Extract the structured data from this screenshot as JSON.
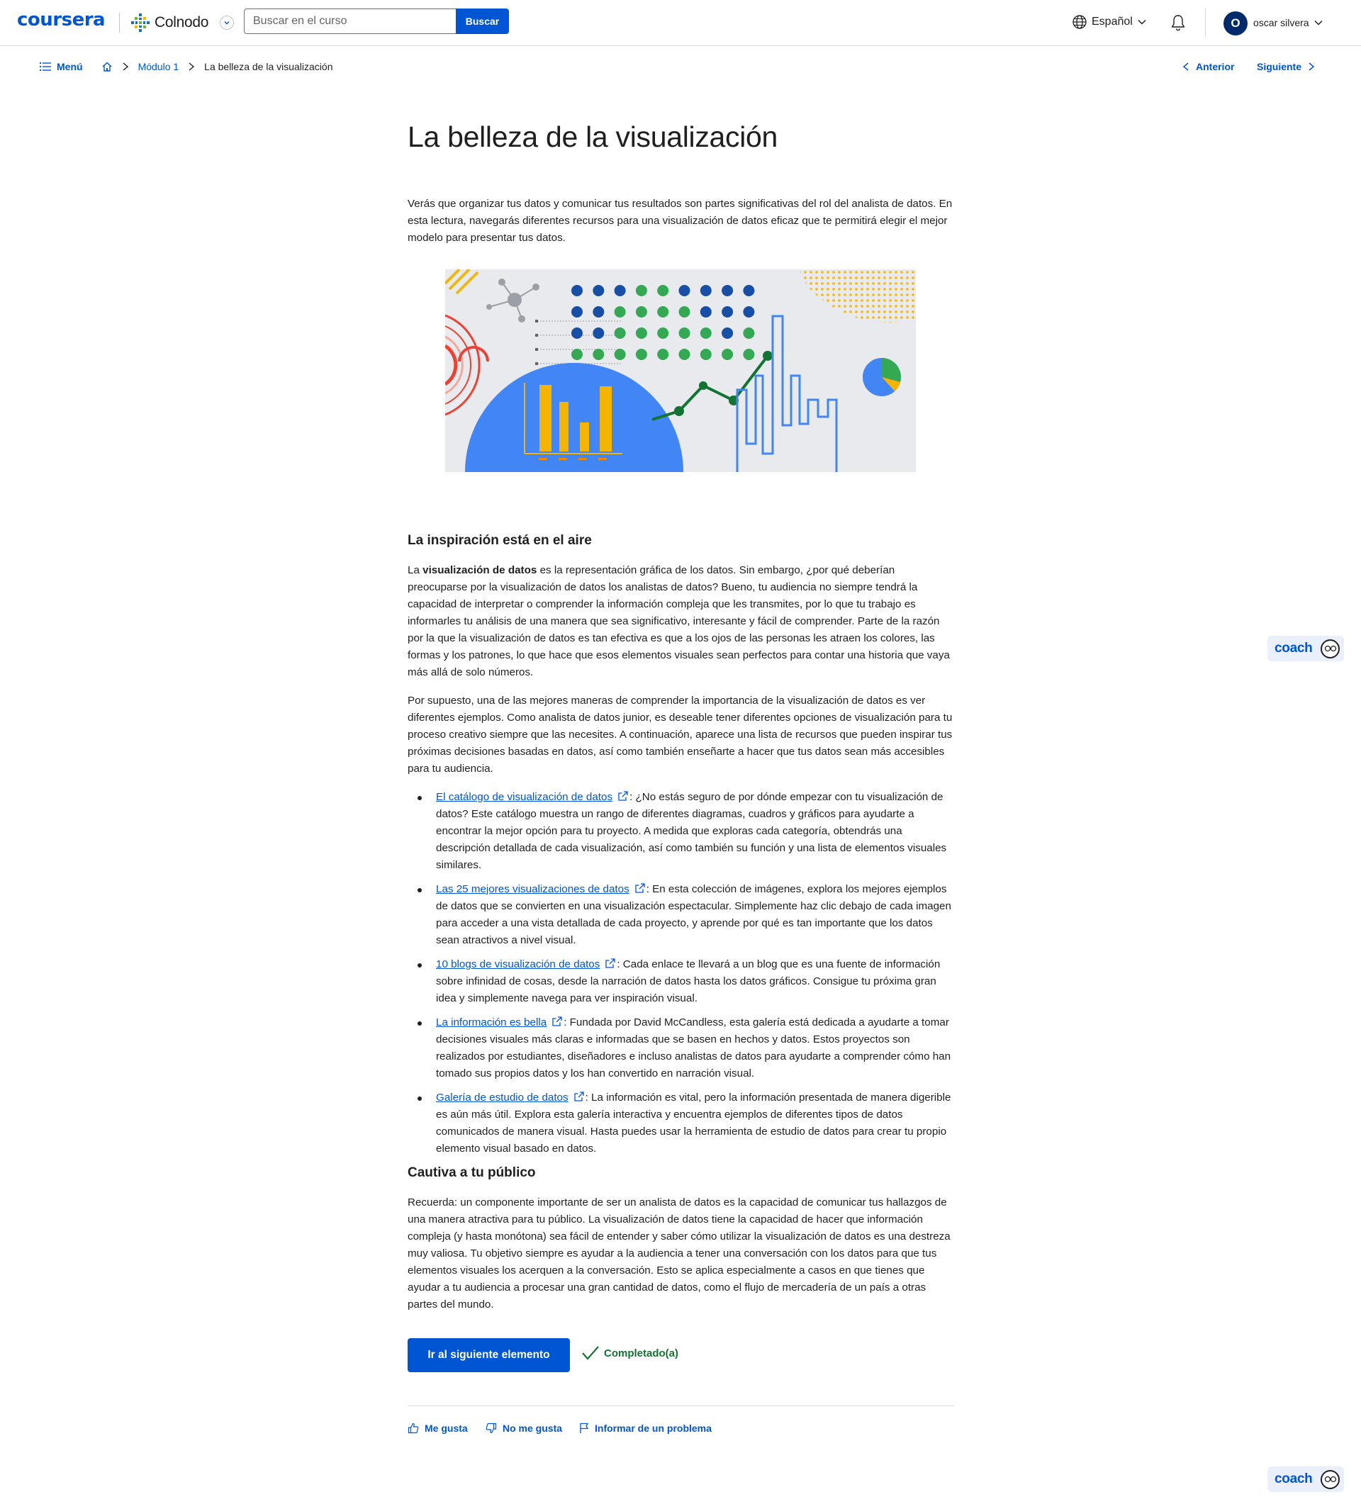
{
  "header": {
    "logo": "coursera",
    "partner": "Colnodo",
    "search_placeholder": "Buscar en el curso",
    "search_button": "Buscar",
    "language": "Español",
    "avatar_initial": "O",
    "user_name": "oscar silvera"
  },
  "breadcrumb": {
    "menu": "Menú",
    "module": "Módulo 1",
    "current": "La belleza de la visualización",
    "prev": "Anterior",
    "next": "Siguiente"
  },
  "article": {
    "title": "La belleza de la visualización",
    "intro": "Verás que organizar tus datos y comunicar tus resultados son partes significativas del rol del analista de datos. En esta lectura, navegarás diferentes recursos para una visualización de datos eficaz que te permitirá elegir el mejor modelo para presentar tus datos.",
    "section1_heading": "La inspiración está en el aire",
    "s1_p1_a": "La ",
    "s1_p1_bold": "visualización de datos",
    "s1_p1_b": " es la representación gráfica de los datos. Sin embargo, ¿por qué deberían preocuparse por la visualización de datos los analistas de datos? Bueno, tu audiencia no siempre tendrá la capacidad de interpretar o comprender la información compleja que les transmites, por lo que tu trabajo es informarles tu análisis de una manera que sea significativo, interesante y fácil de comprender. Parte de la razón por la que la visualización de datos es tan efectiva es que a los ojos de las personas les atraen los colores, las formas y los patrones, lo que hace que esos elementos visuales sean perfectos para contar una historia que vaya más allá de solo números.",
    "s1_p2": "Por supuesto, una de las mejores maneras de comprender la importancia de la visualización de datos es ver diferentes ejemplos. Como analista de datos junior, es deseable tener diferentes opciones de visualización para tu proceso creativo siempre que las necesites. A continuación, aparece una lista de recursos que pueden inspirar tus próximas decisiones basadas en datos, así como también enseñarte a hacer que tus datos sean más accesibles para tu audiencia.",
    "resources": [
      {
        "link": "El catálogo de visualización de datos",
        "text": ": ¿No estás seguro de por dónde empezar con tu visualización de datos? Este catálogo muestra un rango de diferentes diagramas, cuadros y gráficos para ayudarte a encontrar la mejor opción para tu proyecto. A medida que exploras cada categoría, obtendrás una descripción detallada de cada visualización, así como también su función y una lista de elementos visuales similares."
      },
      {
        "link": "Las 25 mejores visualizaciones de datos",
        "text": ": En esta colección de imágenes, explora los mejores ejemplos de datos que se convierten en una visualización espectacular. Simplemente haz clic debajo de cada imagen para acceder a una vista detallada de cada proyecto, y aprende por qué es tan importante que los datos sean atractivos a nivel visual."
      },
      {
        "link": "10 blogs de visualización de datos",
        "text": ": Cada enlace te llevará a un blog que es una fuente de información sobre infinidad de cosas, desde la narración de datos hasta los datos gráficos. Consigue tu próxima gran idea y simplemente navega para ver inspiración visual."
      },
      {
        "link": "La información es bella",
        "text": ": Fundada por David McCandless, esta galería está dedicada a ayudarte a tomar decisiones visuales más claras e informadas que se basen en hechos y datos. Estos proyectos son realizados por estudiantes, diseñadores e incluso analistas de datos para ayudarte a comprender cómo han tomado sus propios datos y los han convertido en narración visual."
      },
      {
        "link": "Galería de estudio de datos",
        "text": ": La información es vital, pero la información presentada de manera digerible es aún más útil. Explora esta galería interactiva y encuentra ejemplos de diferentes tipos de datos comunicados de manera visual. Hasta puedes usar la herramienta de estudio de datos para crear tu propio elemento visual basado en datos."
      }
    ],
    "section2_heading": "Cautiva a tu público",
    "s2_p1": "Recuerda: un componente importante de ser un analista de datos es la capacidad de comunicar tus hallazgos de una manera atractiva para tu público. La visualización de datos tiene la capacidad de hacer que información compleja (y hasta monótona) sea fácil de entender y saber cómo utilizar la visualización de datos es una destreza muy valiosa. Tu objetivo siempre es ayudar a la audiencia a tener una conversación con los datos para que tus elementos visuales los acerquen a la conversación. Esto se aplica especialmente a casos en que tienes que ayudar a tu audiencia a procesar una gran cantidad de datos, como el flujo de mercadería de un país a otras partes del mundo."
  },
  "actions": {
    "next_item": "Ir al siguiente elemento",
    "completed": "Completado(a)",
    "like": "Me gusta",
    "dislike": "No me gusta",
    "report": "Informar de un problema"
  },
  "coach": {
    "label": "coach"
  },
  "colors": {
    "primary": "#0056d2",
    "success": "#137333",
    "avatar": "#002a6c"
  }
}
